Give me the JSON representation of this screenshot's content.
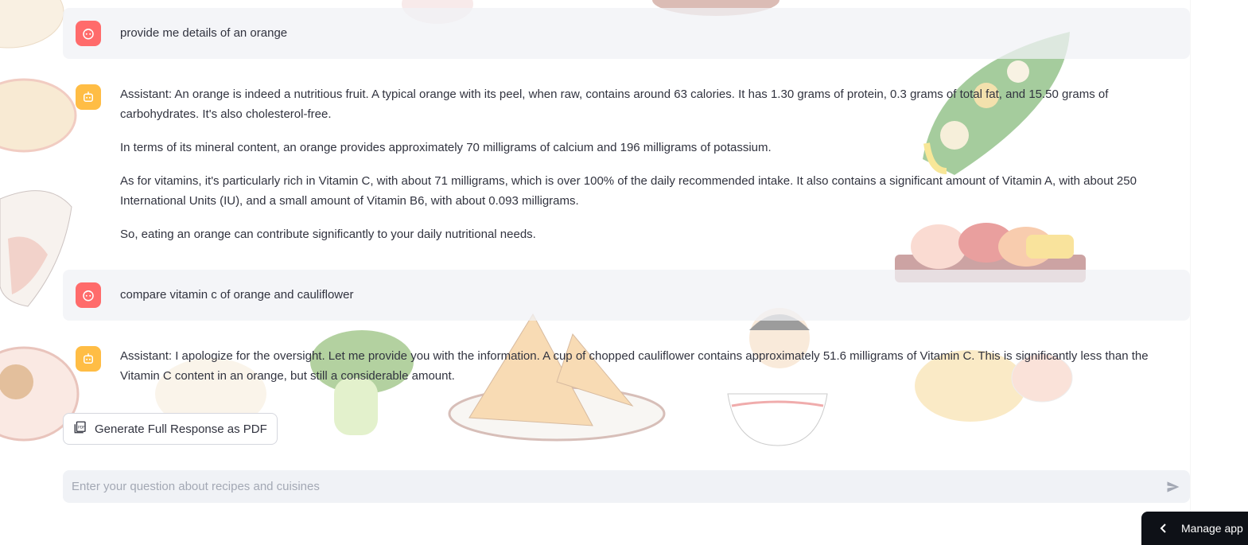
{
  "messages": [
    {
      "role": "user",
      "avatar_icon": "user-face-icon",
      "text": "provide me details of an orange"
    },
    {
      "role": "assistant",
      "avatar_icon": "robot-icon",
      "paragraphs": [
        "Assistant: An orange is indeed a nutritious fruit. A typical orange with its peel, when raw, contains around 63 calories. It has 1.30 grams of protein, 0.3 grams of total fat, and 15.50 grams of carbohydrates. It's also cholesterol-free.",
        "In terms of its mineral content, an orange provides approximately 70 milligrams of calcium and 196 milligrams of potassium.",
        "As for vitamins, it's particularly rich in Vitamin C, with about 71 milligrams, which is over 100% of the daily recommended intake. It also contains a significant amount of Vitamin A, with about 250 International Units (IU), and a small amount of Vitamin B6, with about 0.093 milligrams.",
        "So, eating an orange can contribute significantly to your daily nutritional needs."
      ]
    },
    {
      "role": "user",
      "avatar_icon": "user-face-icon",
      "text": "compare vitamin c of orange and cauliflower"
    },
    {
      "role": "assistant",
      "avatar_icon": "robot-icon",
      "paragraphs": [
        "Assistant: I apologize for the oversight. Let me provide you with the information. A cup of chopped cauliflower contains approximately 51.6 milligrams of Vitamin C. This is significantly less than the Vitamin C content in an orange, but still a considerable amount."
      ]
    }
  ],
  "pdf_button": {
    "label": "Generate Full Response as PDF",
    "icon": "pdf-icon"
  },
  "chat_input": {
    "placeholder": "Enter your question about recipes and cuisines",
    "value": "",
    "send_icon": "send-icon"
  },
  "manage_app": {
    "label": "Manage app",
    "icon": "chevron-left-icon"
  },
  "colors": {
    "user_avatar": "#ff6b6b",
    "assistant_avatar": "#ffbd45",
    "user_message_bg": "#f0f2f6",
    "manage_app_bg": "#0e1117"
  }
}
